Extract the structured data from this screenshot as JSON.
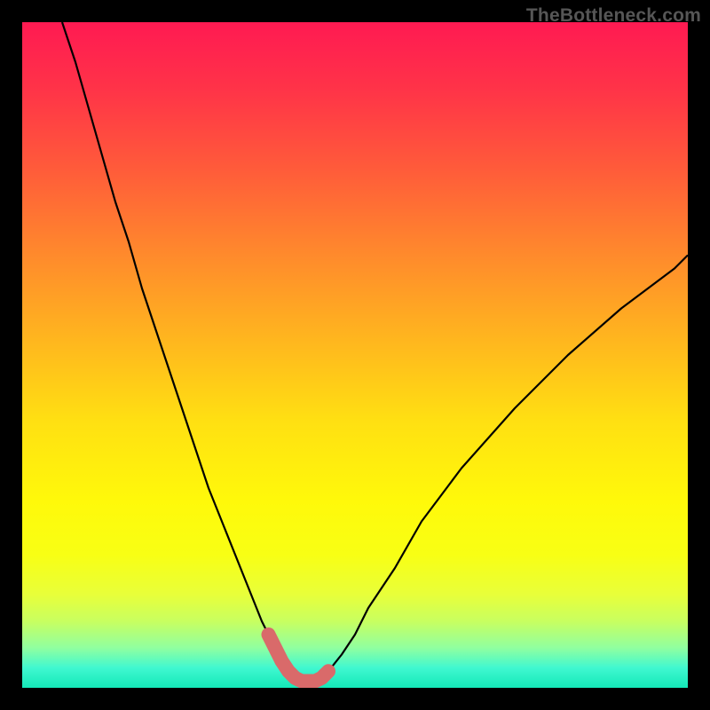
{
  "watermark": "TheBottleneck.com",
  "chart_data": {
    "type": "line",
    "title": "",
    "xlabel": "",
    "ylabel": "",
    "xlim": [
      0,
      100
    ],
    "ylim": [
      0,
      100
    ],
    "grid": false,
    "legend": false,
    "background": {
      "style": "vertical-gradient",
      "meaning": "bottleneck severity gradient (red=high, green=low)"
    },
    "x": [
      6,
      8,
      10,
      12,
      14,
      16,
      18,
      20,
      22,
      24,
      26,
      28,
      30,
      32,
      34,
      36,
      37,
      38,
      39,
      40,
      41,
      42,
      43,
      44,
      45,
      46,
      48,
      50,
      52,
      56,
      60,
      66,
      74,
      82,
      90,
      98,
      100
    ],
    "values": [
      100,
      94,
      87,
      80,
      73,
      67,
      60,
      54,
      48,
      42,
      36,
      30,
      25,
      20,
      15,
      10,
      8,
      6,
      4,
      2.5,
      1.5,
      1,
      1,
      1,
      1.5,
      2.5,
      5,
      8,
      12,
      18,
      25,
      33,
      42,
      50,
      57,
      63,
      65
    ],
    "highlight_region": {
      "x_start": 37,
      "x_end": 47,
      "style": "thick-coral-overlay"
    }
  }
}
